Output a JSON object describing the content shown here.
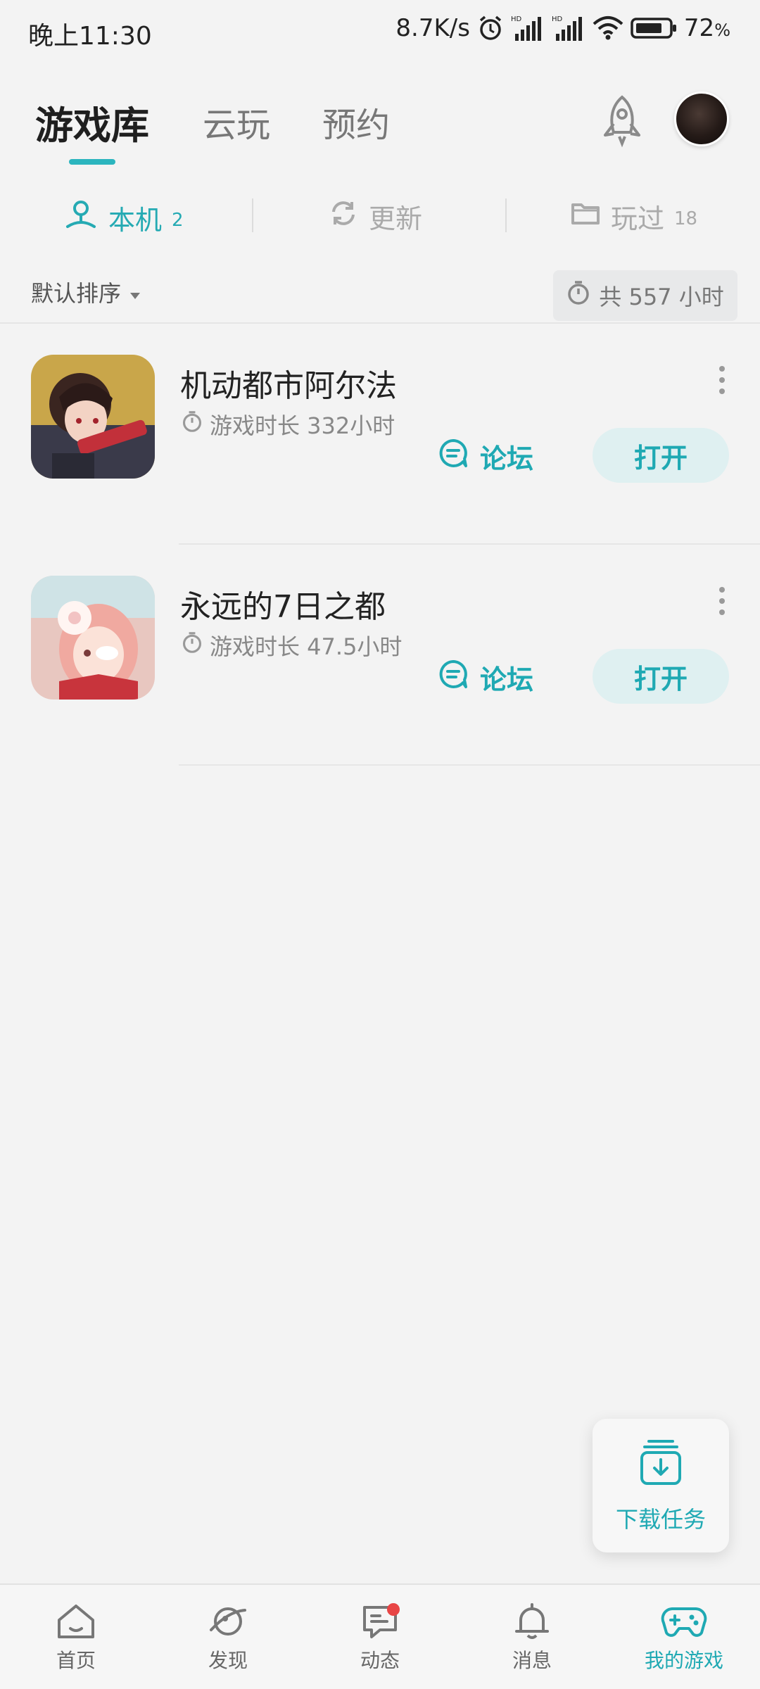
{
  "status_bar": {
    "time": "晚上11:30",
    "net_speed": "8.7K/s",
    "battery": "72",
    "battery_suffix": "%",
    "icons": [
      "alarm-icon",
      "hd-signal-icon",
      "hd-signal-icon",
      "wifi-icon",
      "battery-icon"
    ]
  },
  "header": {
    "tabs": [
      {
        "label": "游戏库",
        "active": true
      },
      {
        "label": "云玩",
        "active": false
      },
      {
        "label": "预约",
        "active": false
      }
    ],
    "icons": [
      "rocket-icon",
      "avatar"
    ]
  },
  "sub_tabs": [
    {
      "label": "本机",
      "count": "2",
      "icon": "local-device-icon",
      "active": true
    },
    {
      "label": "更新",
      "count": "",
      "icon": "refresh-icon",
      "active": false
    },
    {
      "label": "玩过",
      "count": "18",
      "icon": "folder-icon",
      "active": false
    }
  ],
  "sort": {
    "label": "默认排序"
  },
  "total": {
    "text": "共 557 小时"
  },
  "games": [
    {
      "name": "机动都市阿尔法",
      "time": "游戏时长 332小时",
      "forum_label": "论坛",
      "open_label": "打开"
    },
    {
      "name": "永远的7日之都",
      "time": "游戏时长 47.5小时",
      "forum_label": "论坛",
      "open_label": "打开"
    }
  ],
  "download_fab": {
    "label": "下载任务"
  },
  "bottom_nav": [
    {
      "label": "首页",
      "icon": "home-icon"
    },
    {
      "label": "发现",
      "icon": "discover-planet-icon"
    },
    {
      "label": "动态",
      "icon": "feed-chat-icon",
      "badge": true
    },
    {
      "label": "消息",
      "icon": "bell-icon"
    },
    {
      "label": "我的游戏",
      "icon": "gamepad-icon",
      "active": true
    }
  ],
  "colors": {
    "accent": "#1fa9b3",
    "background": "#f3f3f3",
    "badge": "#e84545"
  }
}
